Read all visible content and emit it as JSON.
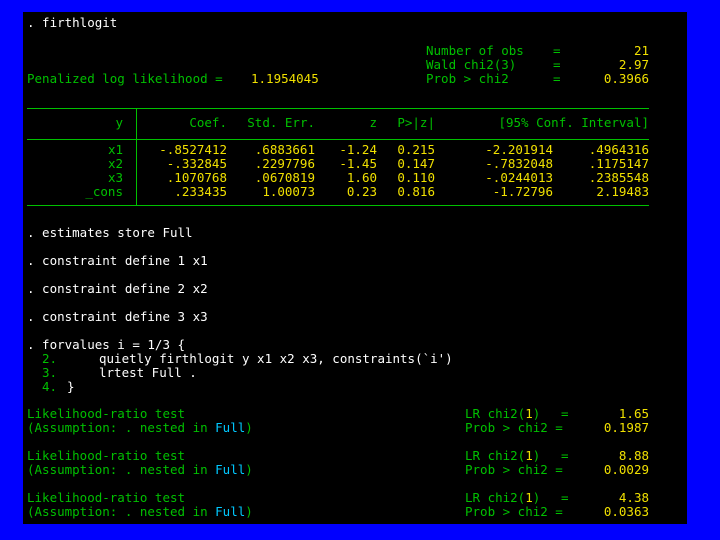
{
  "cmd_firthlogit": ". firthlogit",
  "header": {
    "nobs_label": "Number of obs",
    "nobs_value": "21",
    "wald_label": "Wald chi2(3)",
    "wald_value": "2.97",
    "prob_label": "Prob > chi2",
    "prob_value": "0.3966",
    "ll_label": "Penalized log likelihood =",
    "ll_value": "1.1954045",
    "eq": "="
  },
  "table": {
    "depvar": "y",
    "columns": [
      "Coef.",
      "Std. Err.",
      "z",
      "P>|z|",
      "[95% Conf. Interval]"
    ],
    "rows": [
      {
        "name": "x1",
        "coef": "-.8527412",
        "se": ".6883661",
        "z": "-1.24",
        "p": "0.215",
        "lo": "-2.201914",
        "hi": ".4964316"
      },
      {
        "name": "x2",
        "coef": "-.332845",
        "se": ".2297796",
        "z": "-1.45",
        "p": "0.147",
        "lo": "-.7832048",
        "hi": ".1175147"
      },
      {
        "name": "x3",
        "coef": ".1070768",
        "se": ".0670819",
        "z": "1.60",
        "p": "0.110",
        "lo": "-.0244013",
        "hi": ".2385548"
      },
      {
        "name": "_cons",
        "coef": ".233435",
        "se": "1.00073",
        "z": "0.23",
        "p": "0.816",
        "lo": "-1.72796",
        "hi": "2.19483"
      }
    ]
  },
  "commands": [
    ". estimates store Full",
    ". constraint define 1 x1",
    ". constraint define 2 x2",
    ". constraint define 3 x3",
    ". forvalues i = 1/3 {"
  ],
  "loop": {
    "n2": "2.",
    "l2": "quietly firthlogit y x1 x2 x3, constraints(`i')",
    "n3": "3.",
    "l3": "lrtest Full .",
    "n4": "4.",
    "l4": "}"
  },
  "lrtests": [
    {
      "title": "Likelihood-ratio test",
      "a1": "(Assumption: . nested in ",
      "a_model": "Full",
      "a2": ")",
      "lr_pre": "LR chi2(",
      "lr_df": "1",
      "lr_post": ")",
      "lr_eq": "=",
      "lr_value": "1.65",
      "prob_label": "Prob > chi2 =",
      "prob_value": "0.1987"
    },
    {
      "title": "Likelihood-ratio test",
      "a1": "(Assumption: . nested in ",
      "a_model": "Full",
      "a2": ")",
      "lr_pre": "LR chi2(",
      "lr_df": "1",
      "lr_post": ")",
      "lr_eq": "=",
      "lr_value": "8.88",
      "prob_label": "Prob > chi2 =",
      "prob_value": "0.0029"
    },
    {
      "title": "Likelihood-ratio test",
      "a1": "(Assumption: . nested in ",
      "a_model": "Full",
      "a2": ")",
      "lr_pre": "LR chi2(",
      "lr_df": "1",
      "lr_post": ")",
      "lr_eq": "=",
      "lr_value": "4.38",
      "prob_label": "Prob > chi2 =",
      "prob_value": "0.0363"
    }
  ],
  "colors": {
    "background": "#0000ff",
    "console": "#000000",
    "result": "#f0e000",
    "text": "#00c000",
    "input": "#ffffff",
    "link": "#00c8ff"
  }
}
